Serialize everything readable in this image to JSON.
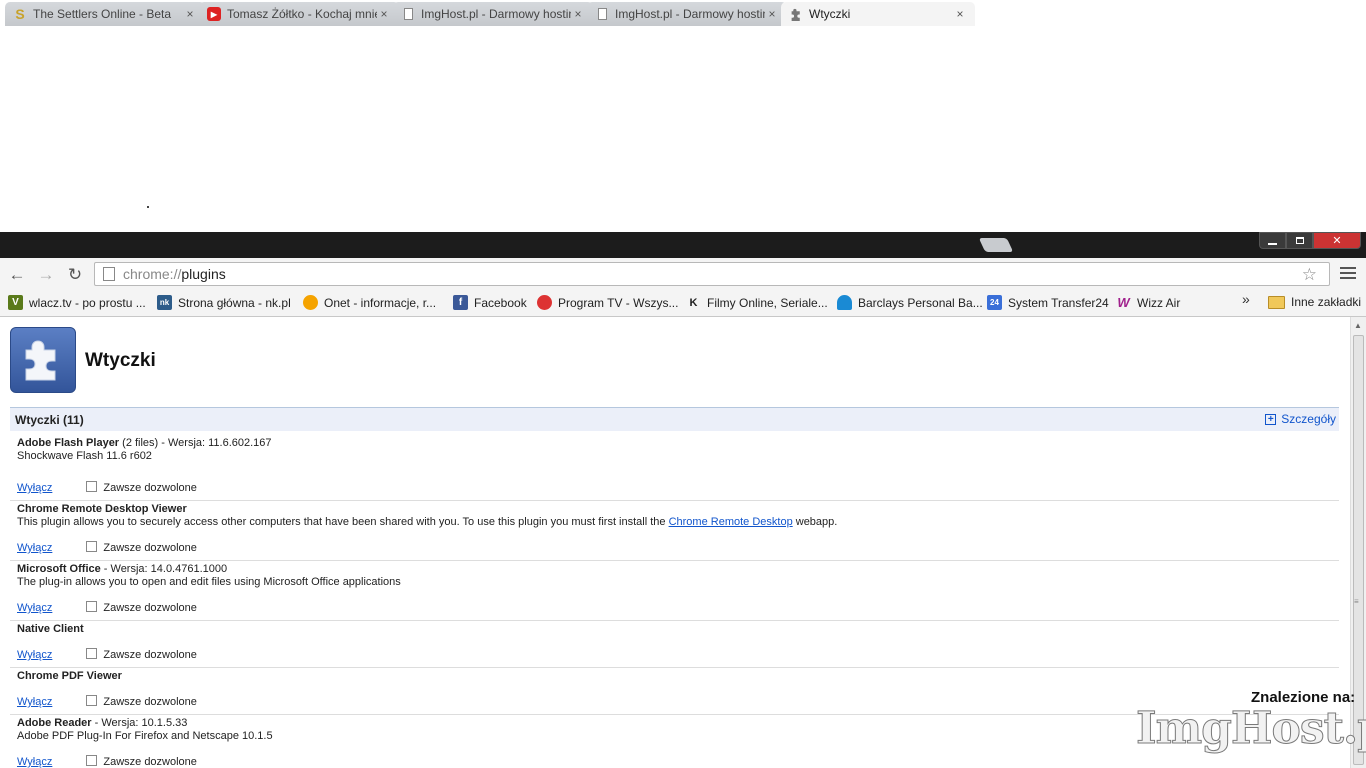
{
  "browser": {
    "tabs": [
      {
        "title": "The Settlers Online - Beta",
        "favicon": "S",
        "favicon_color": "#c8a22a"
      },
      {
        "title": "Tomasz Żółtko - Kochaj mnie",
        "favicon": "▶",
        "favicon_color": "#d22"
      },
      {
        "title": "ImgHost.pl - Darmowy hosting",
        "favicon": "page-icon",
        "favicon_color": "#888"
      },
      {
        "title": "ImgHost.pl - Darmowy hosting",
        "favicon": "page-icon",
        "favicon_color": "#888"
      },
      {
        "title": "Wtyczki",
        "favicon": "puzzle-icon",
        "favicon_color": "#666",
        "active": true
      }
    ],
    "tab_close": "×",
    "address": {
      "scheme": "chrome://",
      "path": "plugins"
    },
    "bookmarks": [
      {
        "label": "wlacz.tv - po prostu ...",
        "icon": "V",
        "color": "#5a7a1a"
      },
      {
        "label": "Strona główna - nk.pl",
        "icon": "nk",
        "color": "#2d5c8a"
      },
      {
        "label": "Onet - informacje, r...",
        "icon": "",
        "color": "#f5a300"
      },
      {
        "label": "Facebook",
        "icon": "f",
        "color": "#3b5998"
      },
      {
        "label": "Program TV - Wszys...",
        "icon": "",
        "color": "#d33"
      },
      {
        "label": "Filmy Online, Seriale...",
        "icon": "K",
        "color": "#222"
      },
      {
        "label": "Barclays Personal Ba...",
        "icon": "",
        "color": "#1a8ad4"
      },
      {
        "label": "System Transfer24",
        "icon": "24",
        "color": "#3a6fd8"
      },
      {
        "label": "Wizz Air",
        "icon": "W",
        "color": "#a0208c"
      }
    ],
    "bookmarks_more": "»",
    "other_bookmarks": "Inne zakładki"
  },
  "page": {
    "title": "Wtyczki",
    "section_title": "Wtyczki (11)",
    "details_label": "Szczegóły",
    "disable_label": "Wyłącz",
    "always_allow_label": "Zawsze dozwolone",
    "plugins": [
      {
        "name": "Adobe Flash Player",
        "meta": " (2 files) - Wersja: 11.6.602.167",
        "desc": "Shockwave Flash 11.6 r602"
      },
      {
        "name": "Chrome Remote Desktop Viewer",
        "meta": "",
        "desc_pre": "This plugin allows you to securely access other computers that have been shared with you. To use this plugin you must first install the ",
        "desc_link": "Chrome Remote Desktop",
        "desc_post": " webapp."
      },
      {
        "name": "Microsoft Office",
        "meta": " - Wersja: 14.0.4761.1000",
        "desc": "The plug-in allows you to open and edit files using Microsoft Office applications"
      },
      {
        "name": "Native Client",
        "meta": "",
        "desc": ""
      },
      {
        "name": "Chrome PDF Viewer",
        "meta": "",
        "desc": ""
      },
      {
        "name": "Adobe Reader",
        "meta": " - Wersja: 10.1.5.33",
        "desc": "Adobe PDF Plug-In For Firefox and Netscape 10.1.5"
      }
    ]
  },
  "watermark": {
    "found_on": "Znalezione na:",
    "logo": "ImgHost.pl"
  }
}
